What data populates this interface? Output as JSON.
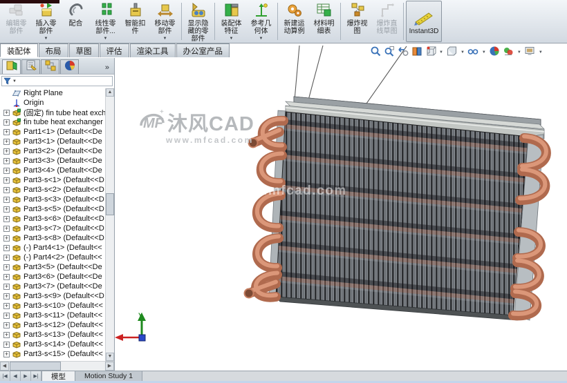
{
  "colors": {
    "copper": "#c67f62",
    "copper_dark": "#a35f44",
    "copper_light": "#e5a184",
    "fin_dark": "#2c2e31",
    "fin_light": "#868b90",
    "frame": "#c3c7c4",
    "accent_blue": "#3a72b8"
  },
  "toolbar": {
    "buttons": [
      {
        "label": "编辑零\n部件",
        "icon": "edit-component-icon",
        "state": "disabled",
        "dropdown": false
      },
      {
        "label": "插入零\n部件",
        "icon": "insert-component-icon",
        "state": "normal",
        "dropdown": true
      },
      {
        "label": "配合",
        "icon": "mate-icon",
        "state": "normal",
        "dropdown": false
      },
      {
        "label": "线性零\n部件...",
        "icon": "linear-pattern-icon",
        "state": "normal",
        "dropdown": true
      },
      {
        "label": "智能扣\n件",
        "icon": "smart-fasteners-icon",
        "state": "normal",
        "dropdown": false
      },
      {
        "label": "移动零\n部件",
        "icon": "move-component-icon",
        "state": "normal",
        "dropdown": true
      },
      {
        "label": "显示隐\n藏的零\n部件",
        "icon": "show-hidden-components-icon",
        "state": "normal",
        "dropdown": false
      },
      {
        "label": "装配体\n特征",
        "icon": "assembly-features-icon",
        "state": "normal",
        "dropdown": true
      },
      {
        "label": "参考几\n何体",
        "icon": "reference-geometry-icon",
        "state": "normal",
        "dropdown": true
      },
      {
        "label": "新建运\n动算例",
        "icon": "new-motion-study-icon",
        "state": "normal",
        "dropdown": false
      },
      {
        "label": "材料明\n细表",
        "icon": "bill-of-materials-icon",
        "state": "normal",
        "dropdown": false
      },
      {
        "label": "爆炸视\n图",
        "icon": "exploded-view-icon",
        "state": "normal",
        "dropdown": false
      },
      {
        "label": "爆炸直\n线草图",
        "icon": "explode-line-sketch-icon",
        "state": "disabled",
        "dropdown": false
      },
      {
        "label": "Instant3D",
        "icon": "instant3d-icon",
        "state": "pressed",
        "dropdown": false
      }
    ]
  },
  "command_tabs": {
    "items": [
      "装配体",
      "布局",
      "草图",
      "评估",
      "渲染工具",
      "办公室产品"
    ],
    "active": "装配体"
  },
  "panel": {
    "manager_tabs": [
      {
        "icon": "featuremanager-tree-icon",
        "active": true
      },
      {
        "icon": "propertymanager-icon",
        "active": false
      },
      {
        "icon": "configurationmanager-icon",
        "active": false
      },
      {
        "icon": "displaymanager-icon",
        "active": false
      }
    ],
    "overflow_chevron": "»",
    "filter": {
      "icon": "filter-funnel-icon",
      "caret": "▼"
    },
    "tree": {
      "items": [
        {
          "label": "Right Plane",
          "icon": "plane",
          "expandable": false
        },
        {
          "label": "Origin",
          "icon": "origin",
          "expandable": false
        },
        {
          "label": "(固定) fin tube heat exch",
          "icon": "assembly",
          "expandable": true
        },
        {
          "label": "fin tube heat exchanger",
          "icon": "assembly",
          "expandable": true
        },
        {
          "label": "Part1<1> (Default<<De",
          "icon": "part",
          "expandable": true
        },
        {
          "label": "Part3<1> (Default<<De",
          "icon": "part",
          "expandable": true
        },
        {
          "label": "Part3<2> (Default<<De",
          "icon": "part",
          "expandable": true
        },
        {
          "label": "Part3<3> (Default<<De",
          "icon": "part",
          "expandable": true
        },
        {
          "label": "Part3<4> (Default<<De",
          "icon": "part",
          "expandable": true
        },
        {
          "label": "Part3-s<1> (Default<<D",
          "icon": "part",
          "expandable": true
        },
        {
          "label": "Part3-s<2> (Default<<D",
          "icon": "part",
          "expandable": true
        },
        {
          "label": "Part3-s<3> (Default<<D",
          "icon": "part",
          "expandable": true
        },
        {
          "label": "Part3-s<5> (Default<<D",
          "icon": "part",
          "expandable": true
        },
        {
          "label": "Part3-s<6> (Default<<D",
          "icon": "part",
          "expandable": true
        },
        {
          "label": "Part3-s<7> (Default<<D",
          "icon": "part",
          "expandable": true
        },
        {
          "label": "Part3-s<8> (Default<<D",
          "icon": "part",
          "expandable": true
        },
        {
          "label": "(-) Part4<1> (Default<<",
          "icon": "part",
          "expandable": true
        },
        {
          "label": "(-) Part4<2> (Default<<",
          "icon": "part",
          "expandable": true
        },
        {
          "label": "Part3<5> (Default<<De",
          "icon": "part",
          "expandable": true
        },
        {
          "label": "Part3<6> (Default<<De",
          "icon": "part",
          "expandable": true
        },
        {
          "label": "Part3<7> (Default<<De",
          "icon": "part",
          "expandable": true
        },
        {
          "label": "Part3-s<9> (Default<<D",
          "icon": "part",
          "expandable": true
        },
        {
          "label": "Part3-s<10> (Default<<",
          "icon": "part",
          "expandable": true
        },
        {
          "label": "Part3-s<11> (Default<<",
          "icon": "part",
          "expandable": true
        },
        {
          "label": "Part3-s<12> (Default<<",
          "icon": "part",
          "expandable": true
        },
        {
          "label": "Part3-s<13> (Default<<",
          "icon": "part",
          "expandable": true
        },
        {
          "label": "Part3-s<14> (Default<<",
          "icon": "part",
          "expandable": true
        },
        {
          "label": "Part3-s<15> (Default<<",
          "icon": "part",
          "expandable": true
        }
      ]
    }
  },
  "viewport": {
    "headsup_icons": [
      {
        "icon": "zoom-to-fit-icon",
        "dropdown": false
      },
      {
        "icon": "zoom-to-area-icon",
        "dropdown": false
      },
      {
        "icon": "previous-view-icon",
        "dropdown": false
      },
      {
        "icon": "section-view-icon",
        "dropdown": false
      },
      {
        "icon": "view-orientation-icon",
        "dropdown": true
      },
      {
        "icon": "display-style-icon",
        "dropdown": true
      },
      {
        "icon": "hide-show-items-icon",
        "dropdown": true
      },
      {
        "icon": "apply-scene-icon",
        "dropdown": false
      },
      {
        "icon": "edit-appearance-icon",
        "dropdown": true
      },
      {
        "icon": "view-settings-icon",
        "dropdown": true
      }
    ],
    "brand_watermark": {
      "logo": "MF",
      "title": "沐风CAD",
      "url": "www.mfcad.com"
    },
    "model_watermark": "www.mfcad.com",
    "triad": {
      "x_label": "X",
      "y_label": "Y"
    }
  },
  "bottom_bar": {
    "nav_buttons": [
      "|◀",
      "◀",
      "▶",
      "▶|"
    ],
    "tabs": [
      {
        "label": "模型",
        "active": true
      },
      {
        "label": "Motion Study 1",
        "active": false
      }
    ]
  }
}
